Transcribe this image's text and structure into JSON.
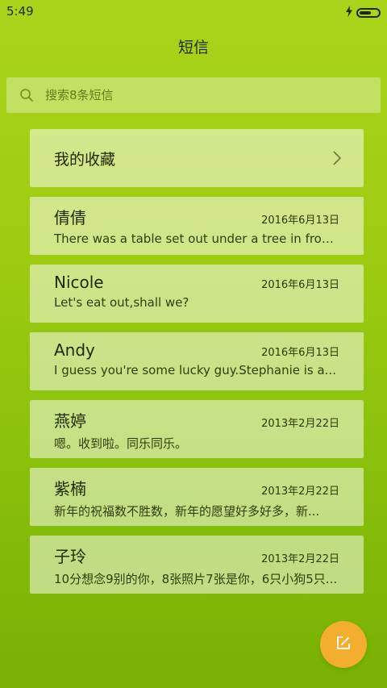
{
  "status_bar": {
    "time": "5:49",
    "icons": [
      "charging-icon",
      "battery-icon"
    ]
  },
  "header": {
    "title": "短信"
  },
  "search": {
    "placeholder": "搜索8条短信",
    "icon": "search-icon"
  },
  "favorites": {
    "label": "我的收藏",
    "icon": "chevron-right-icon"
  },
  "messages": [
    {
      "name": "倩倩",
      "date": "2016年6月13日",
      "preview": "There was a table set out under a tree in front..."
    },
    {
      "name": "Nicole",
      "date": "2016年6月13日",
      "preview": "Let's eat out,shall we?"
    },
    {
      "name": "Andy",
      "date": "2016年6月13日",
      "preview": "I guess you're some lucky guy.Stephanie is a..."
    },
    {
      "name": "燕婷",
      "date": "2013年2月22日",
      "preview": "嗯。收到啦。同乐同乐。"
    },
    {
      "name": "紫楠",
      "date": "2013年2月22日",
      "preview": "新年的祝福数不胜数，新年的愿望好多好多，新..."
    },
    {
      "name": "子玲",
      "date": "2013年2月22日",
      "preview": "10分想念9别的你，8张照片7张是你，6只小狗5只..."
    }
  ],
  "compose": {
    "icon": "compose-icon"
  },
  "colors": {
    "background_top": "#a9d41b",
    "background_bottom": "#78b104",
    "card": "#ffffff80",
    "fab": "#f3ae2f"
  }
}
